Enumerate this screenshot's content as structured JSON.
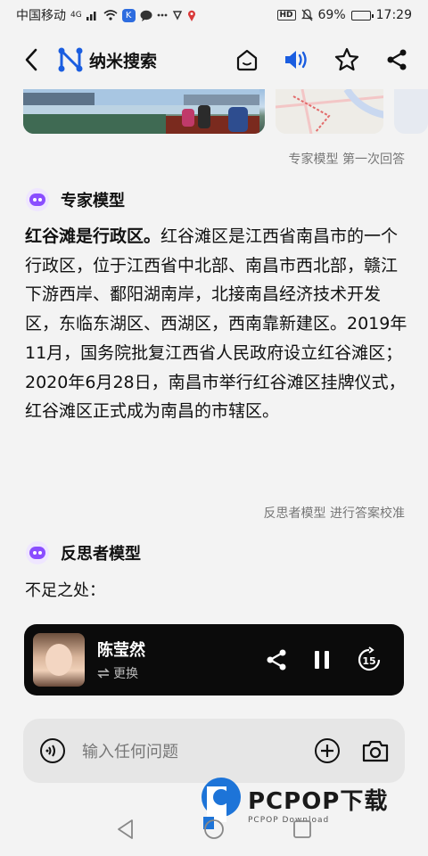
{
  "status_bar": {
    "carrier": "中国移动",
    "network": "4G",
    "battery": "69%",
    "time": "17:29",
    "hd_label": "HD",
    "k_label": "K"
  },
  "header": {
    "title": "纳米搜索",
    "accent_color": "#1a5de0"
  },
  "answer_meta": "专家模型  第一次回答",
  "expert": {
    "model_name": "专家模型",
    "bold_lead": "红谷滩是行政区。",
    "body": "红谷滩区是江西省南昌市的一个行政区，位于江西省中北部、南昌市西北部，赣江下游西岸、鄱阳湖南岸，北接南昌经济技术开发区，东临东湖区、西湖区，西南靠新建区。2019年11月，国务院批复江西省人民政府设立红谷滩区；2020年6月28日，南昌市举行红谷滩区挂牌仪式，红谷滩区正式成为南昌的市辖区。"
  },
  "reflect_meta": "反思者模型  进行答案校准",
  "reflect": {
    "model_name": "反思者模型",
    "text": "不足之处："
  },
  "player": {
    "voice_name": "陈莹然",
    "switch_label": "更换",
    "replay_seconds": "15"
  },
  "input": {
    "placeholder": "输入任何问题"
  },
  "watermark": {
    "brand": "PCPOP下载",
    "sub": "PCPOP Download"
  }
}
